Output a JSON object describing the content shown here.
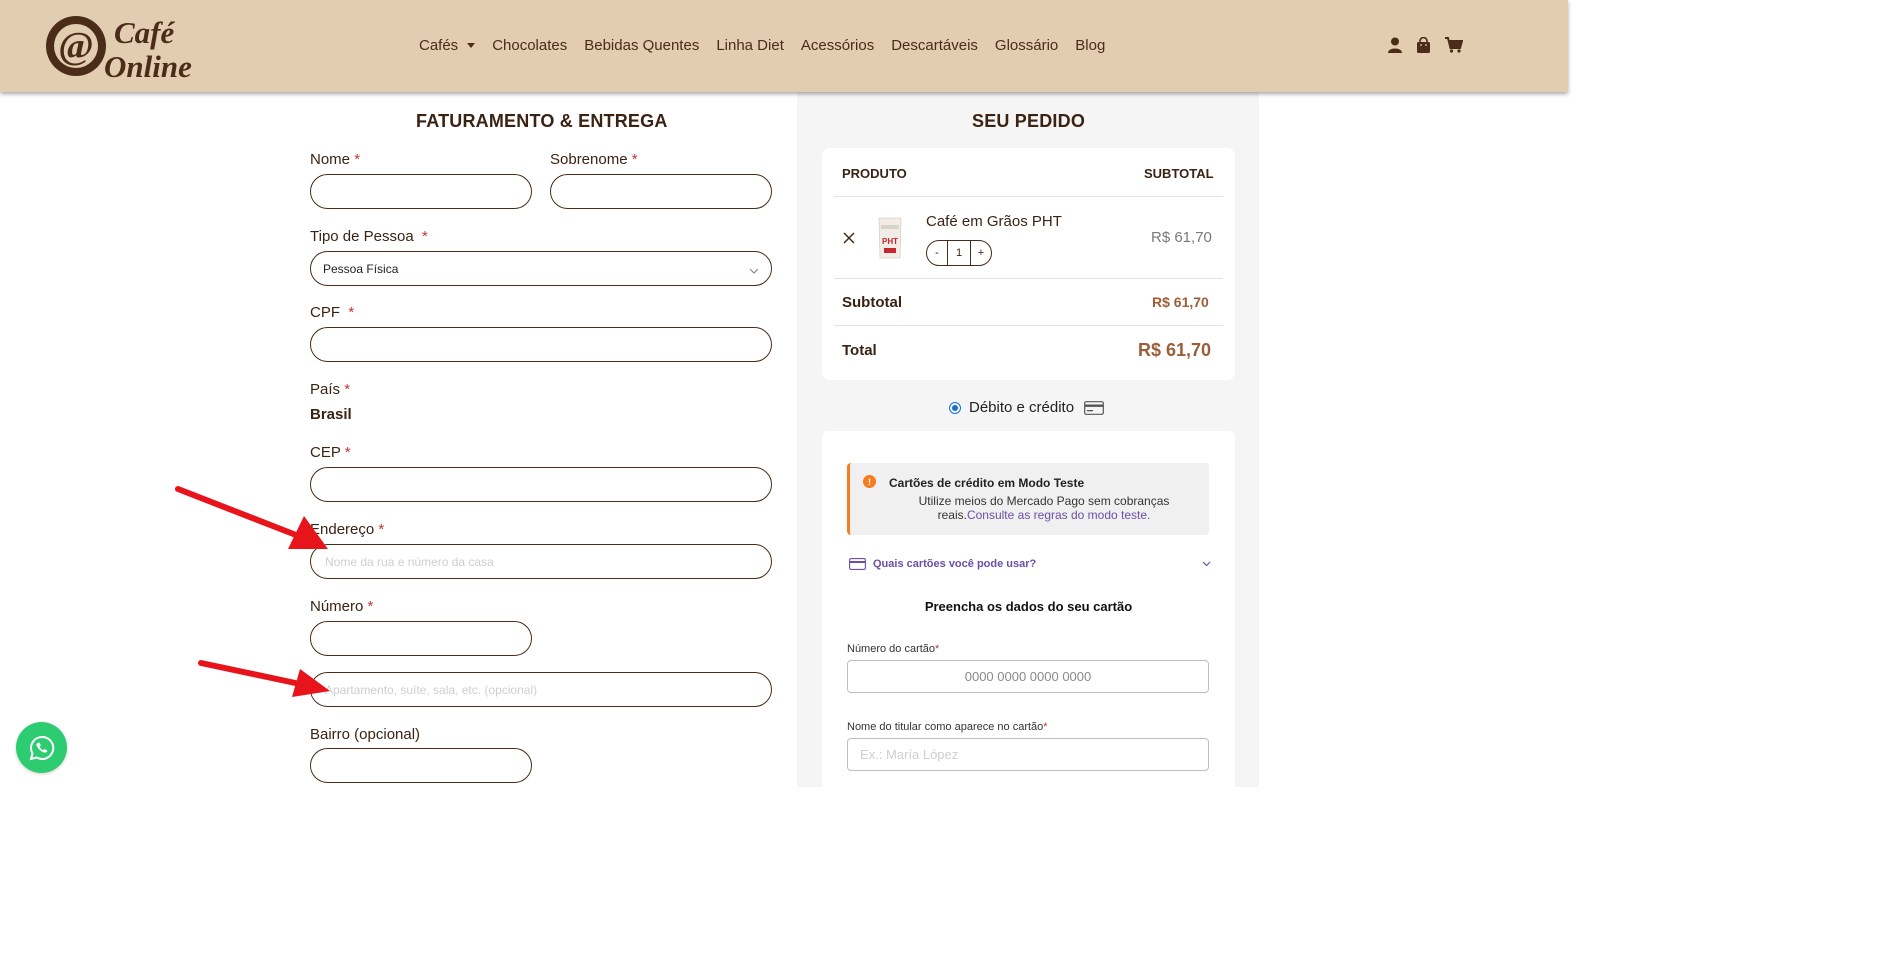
{
  "brand": {
    "line1": "Café",
    "line2": "Online",
    "mark": "@"
  },
  "nav": {
    "items": [
      "Cafés",
      "Chocolates",
      "Bebidas Quentes",
      "Linha Diet",
      "Acessórios",
      "Descartáveis",
      "Glossário",
      "Blog"
    ]
  },
  "header_icons": [
    "user-icon",
    "shopping-bag-icon",
    "cart-icon"
  ],
  "billing": {
    "title": "FATURAMENTO & ENTREGA",
    "required_mark": "*",
    "nome_label": "Nome",
    "sobrenome_label": "Sobrenome",
    "tipo_pessoa_label": "Tipo de Pessoa",
    "tipo_pessoa_value": "Pessoa Física",
    "cpf_label": "CPF",
    "pais_label": "País",
    "pais_value": "Brasil",
    "cep_label": "CEP",
    "endereco_label": "Endereço",
    "endereco_placeholder": "Nome da rua e número da casa",
    "numero_label": "Número",
    "complemento_placeholder": "Apartamento, suíte, sala, etc. (opcional)",
    "bairro_label": "Bairro (opcional)"
  },
  "order": {
    "title": "SEU PEDIDO",
    "col_product": "PRODUTO",
    "col_subtotal": "SUBTOTAL",
    "product_name": "Café em Grãos PHT",
    "thumb_label": "PHT",
    "qty_minus": "-",
    "qty_value": "1",
    "qty_plus": "+",
    "line_price": "R$ 61,70",
    "subtotal_label": "Subtotal",
    "subtotal_value": "R$ 61,70",
    "total_label": "Total",
    "total_value": "R$ 61,70"
  },
  "payment": {
    "method_label": "Débito e crédito",
    "notice_icon": "!",
    "notice_title": "Cartões de crédito em Modo Teste",
    "notice_text": "Utilize meios do Mercado Pago sem cobranças reais.",
    "notice_link": "Consulte as regras do modo teste.",
    "which_cards": "Quais cartões você pode usar?",
    "fill_title": "Preencha os dados do seu cartão",
    "required_mark": "*",
    "card_number_label": "Número do cartão",
    "card_number_placeholder": "0000 0000 0000 0000",
    "holder_label": "Nome do titular como aparece no cartão",
    "holder_placeholder": "Ex.: María López"
  },
  "colors": {
    "header_bg": "#e2cdb0",
    "brand_brown": "#4a2c18",
    "price_accent": "#9b5e38",
    "required_red": "#c0392b",
    "arrow_red": "#e8141b",
    "whatsapp_green": "#2ecc71",
    "notice_orange": "#f57c1f",
    "link_purple": "#6b4fa5",
    "radio_blue": "#1b6fd1"
  }
}
